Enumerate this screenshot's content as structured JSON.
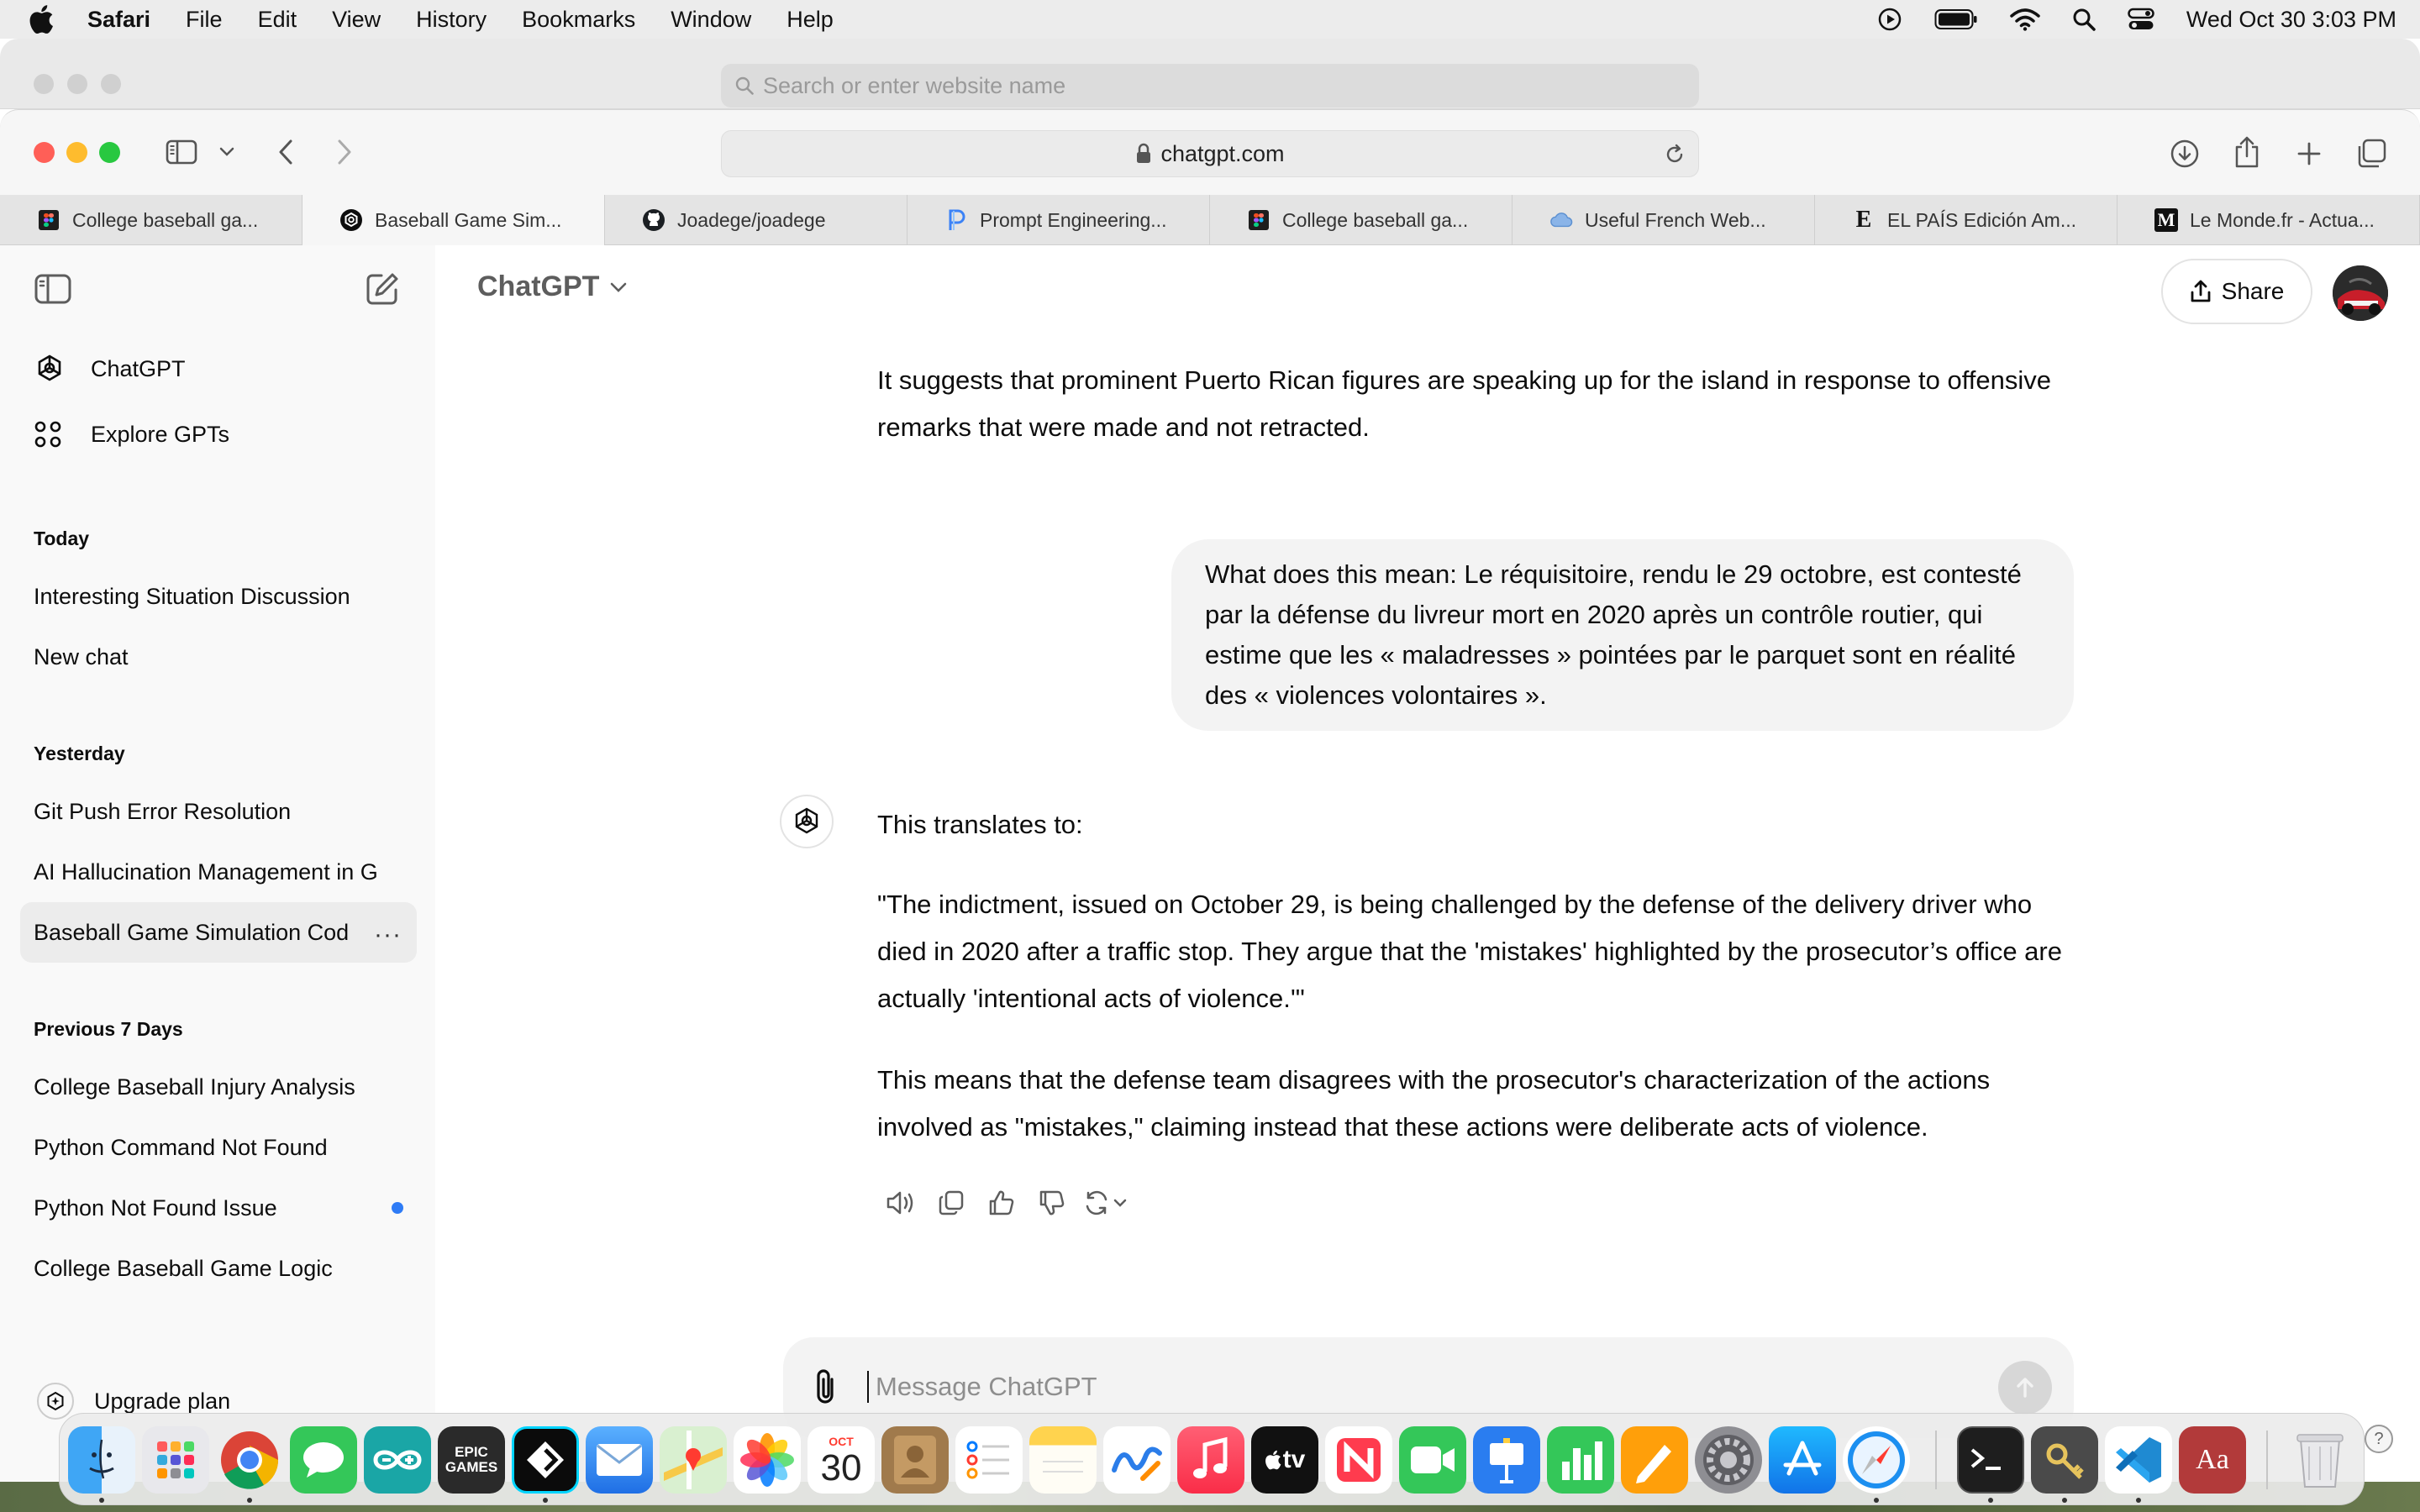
{
  "menubar": {
    "app_name": "Safari",
    "menus": [
      "File",
      "Edit",
      "View",
      "History",
      "Bookmarks",
      "Window",
      "Help"
    ],
    "clock": "Wed Oct 30  3:03 PM"
  },
  "ghost_window": {
    "search_placeholder": "Search or enter website name"
  },
  "toolbar": {
    "url": "chatgpt.com"
  },
  "tabs": [
    {
      "label": "College baseball ga...",
      "favicon": "figma-icon",
      "active": false
    },
    {
      "label": "Baseball Game Sim...",
      "favicon": "chatgpt-icon",
      "active": true
    },
    {
      "label": "Joadege/joadege",
      "favicon": "github-icon",
      "active": false
    },
    {
      "label": "Prompt Engineering...",
      "favicon": "p-icon",
      "active": false
    },
    {
      "label": "College baseball ga...",
      "favicon": "figma-icon",
      "active": false
    },
    {
      "label": "Useful French Web...",
      "favicon": "cloud-icon",
      "active": false
    },
    {
      "label": "EL PAÍS Edición Am...",
      "favicon": "elpais-icon",
      "active": false
    },
    {
      "label": "Le Monde.fr - Actua...",
      "favicon": "lemonde-icon",
      "active": false
    }
  ],
  "sidebar": {
    "nav": [
      {
        "label": "ChatGPT",
        "icon": "openai-logo-icon"
      },
      {
        "label": "Explore GPTs",
        "icon": "grid-icon"
      }
    ],
    "sections": [
      {
        "title": "Today",
        "items": [
          {
            "label": "Interesting Situation Discussion"
          },
          {
            "label": "New chat"
          }
        ]
      },
      {
        "title": "Yesterday",
        "items": [
          {
            "label": "Git Push Error Resolution"
          },
          {
            "label": "AI Hallucination Management in G"
          },
          {
            "label": "Baseball Game Simulation Cod"
          }
        ]
      },
      {
        "title": "Previous 7 Days",
        "items": [
          {
            "label": "College Baseball Injury Analysis"
          },
          {
            "label": "Python Command Not Found"
          },
          {
            "label": "Python Not Found Issue"
          },
          {
            "label": "College Baseball Game Logic"
          }
        ]
      }
    ],
    "more_label": "···",
    "upgrade_label": "Upgrade plan",
    "unread_color": "#2f7cf6"
  },
  "main": {
    "model_label": "ChatGPT",
    "share_label": "Share",
    "prev_answer": "It suggests that prominent Puerto Rican figures are speaking up for the island in response to offensive remarks that were made and not retracted.",
    "user_message": " What does this mean: Le réquisitoire, rendu le 29 octobre, est contesté par la défense du livreur mort en 2020 après un contrôle routier, qui estime que les « maladresses » pointées par le parquet sont en réalité des « violences volontaires ».",
    "answer_intro": "This translates to:",
    "answer_quote": "\"The indictment, issued on October 29, is being challenged by the defense of the delivery driver who died in 2020 after a traffic stop. They argue that the 'mistakes' highlighted by the prosecutor’s office are actually 'intentional acts of violence.'\"",
    "answer_explain": "This means that the defense team disagrees with the prosecutor's characterization of the actions involved as \"mistakes,\" claiming instead that these actions were deliberate acts of violence.",
    "composer_placeholder": "Message ChatGPT"
  },
  "dock": {
    "calendar_month": "OCT",
    "calendar_day": "30",
    "epic_label": "EPIC\nGAMES",
    "dictionary_label": "Aa",
    "tv_label": "tv"
  },
  "help_label": "?"
}
